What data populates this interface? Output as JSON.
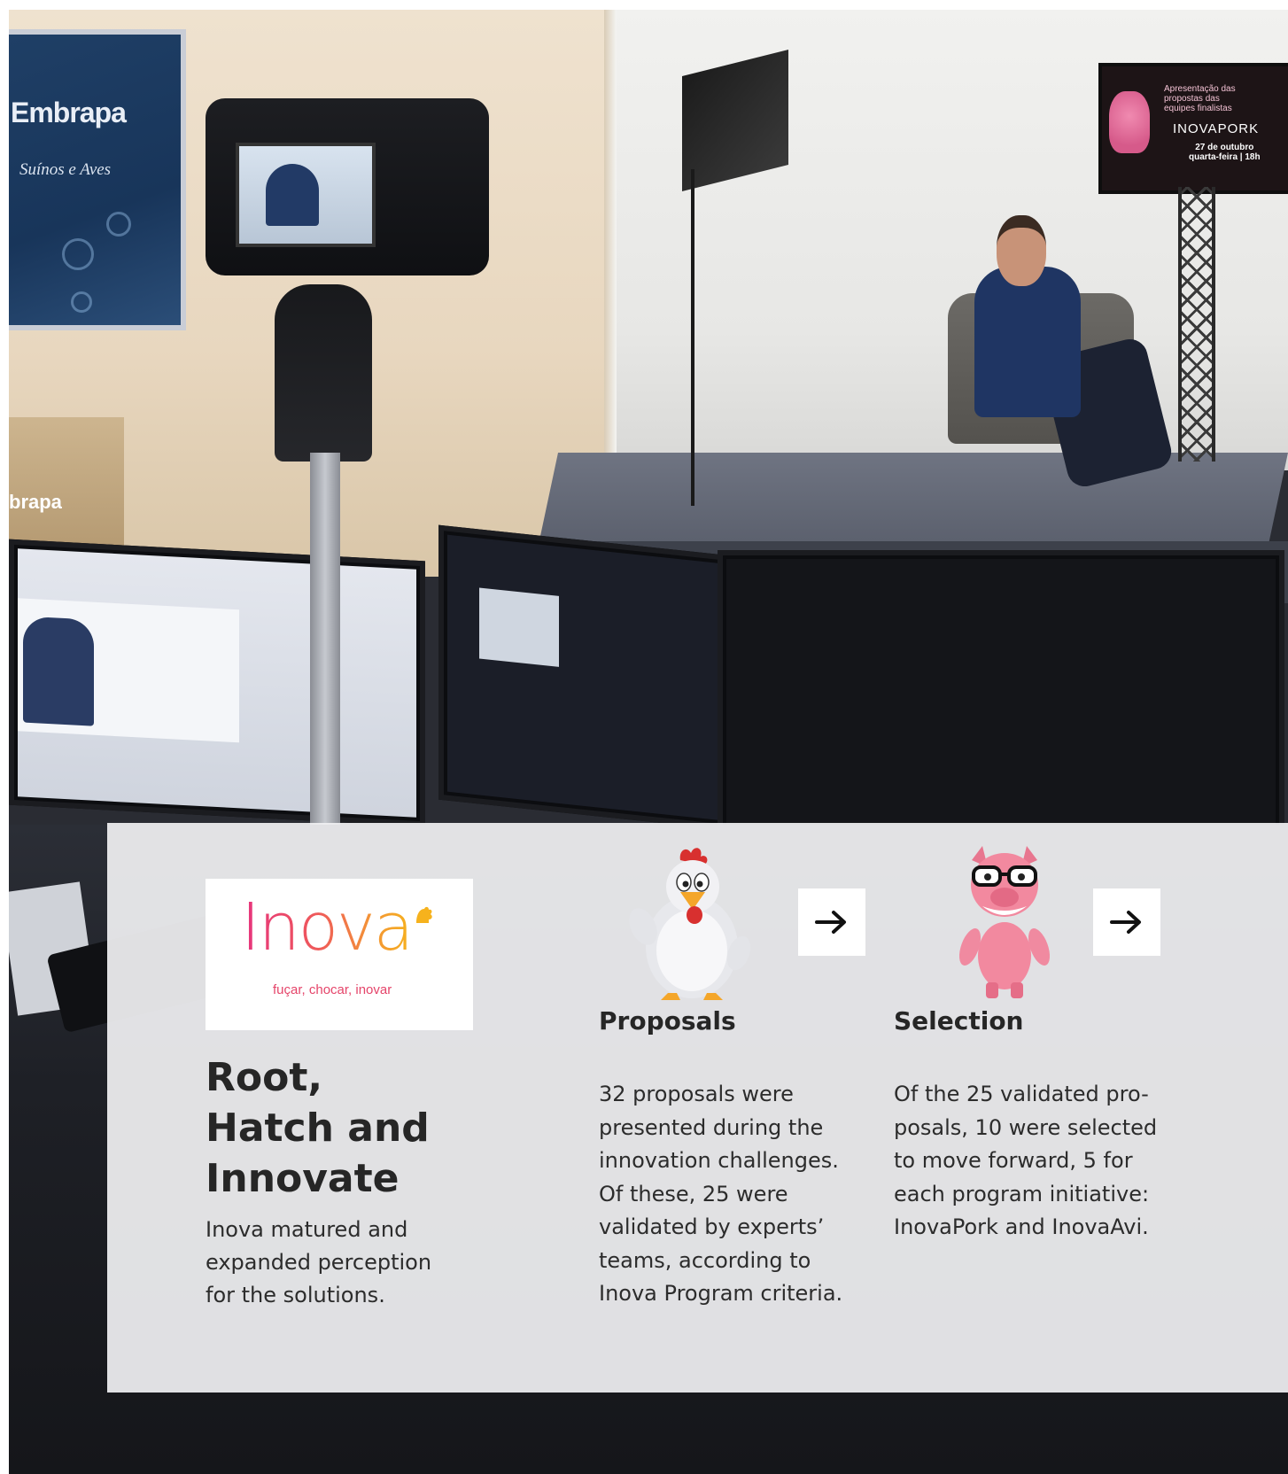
{
  "background_photo": {
    "embrapa_title": "Embrapa",
    "embrapa_subtitle": "Suínos e Aves",
    "podium_text": "brapa",
    "tv_lines": [
      "Apresentação das",
      "propostas das",
      "equipes finalistas"
    ],
    "tv_brand": "INOVAPORK",
    "tv_date_line1": "27 de outubro",
    "tv_date_line2": "quarta-feira | 18h"
  },
  "logo": {
    "word": "Inova",
    "tagline": "fuçar, chocar, inovar",
    "colors": [
      "#e6337e",
      "#f39237",
      "#f6b21d"
    ]
  },
  "intro": {
    "heading": "Root, Hatch and Innovate",
    "text": "Inova matured and expanded perception for the solutions."
  },
  "steps": [
    {
      "mascot": "chicken-mascot",
      "title": "Proposals",
      "text": "32 proposals were presented during the innovation challenges. Of these, 25 were validated by experts’ teams, according to Inova Program criteria."
    },
    {
      "mascot": "pig-mascot",
      "title": "Selection",
      "text": "Of the 25 validated pro-posals, 10 were selected to move forward, 5 for each program initiative: InovaPork and InovaAvi."
    }
  ],
  "arrow_icon": "arrow-right-icon",
  "panel_color": "#f0f0f2"
}
